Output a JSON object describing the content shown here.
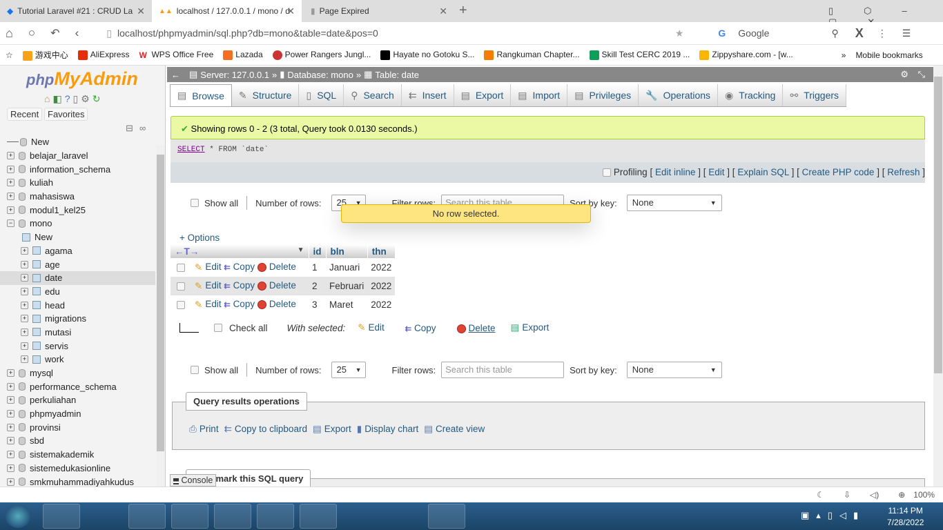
{
  "browser": {
    "tabs": [
      {
        "title": "Tutorial Laravel #21 : CRUD La"
      },
      {
        "title": "localhost / 127.0.0.1 / mono / d"
      },
      {
        "title": "Page Expired"
      }
    ],
    "url": "localhost/phpmyadmin/sql.php?db=mono&table=date&pos=0",
    "search_engine": "Google",
    "bookmarks": [
      "游戏中心",
      "AliExpress",
      "WPS Office Free",
      "Lazada",
      "Power Rangers Jungl...",
      "Hayate no Gotoku S...",
      "Rangkuman Chapter...",
      "Skill Test CERC 2019 ...",
      "Zippyshare.com - [w..."
    ],
    "mobile_bookmarks": "Mobile bookmarks"
  },
  "sidebar": {
    "logo": "phpMyAdmin",
    "recent": "Recent",
    "favorites": "Favorites",
    "tree": [
      {
        "label": "New",
        "type": "new"
      },
      {
        "label": "belajar_laravel"
      },
      {
        "label": "information_schema"
      },
      {
        "label": "kuliah"
      },
      {
        "label": "mahasiswa"
      },
      {
        "label": "modul1_kel25"
      },
      {
        "label": "mono",
        "expanded": true
      },
      {
        "label": "New",
        "type": "new",
        "child": true
      },
      {
        "label": "agama",
        "child": true
      },
      {
        "label": "age",
        "child": true
      },
      {
        "label": "date",
        "child": true,
        "selected": true
      },
      {
        "label": "edu",
        "child": true
      },
      {
        "label": "head",
        "child": true
      },
      {
        "label": "migrations",
        "child": true
      },
      {
        "label": "mutasi",
        "child": true
      },
      {
        "label": "servis",
        "child": true
      },
      {
        "label": "work",
        "child": true
      },
      {
        "label": "mysql"
      },
      {
        "label": "performance_schema"
      },
      {
        "label": "perkuliahan"
      },
      {
        "label": "phpmyadmin"
      },
      {
        "label": "provinsi"
      },
      {
        "label": "sbd"
      },
      {
        "label": "sistemakademik"
      },
      {
        "label": "sistemedukasionline"
      },
      {
        "label": "smkmuhammadiyahkudus"
      }
    ]
  },
  "breadcrumb": {
    "server": "Server: 127.0.0.1",
    "database": "Database: mono",
    "table": "Table: date"
  },
  "menu": [
    "Browse",
    "Structure",
    "SQL",
    "Search",
    "Insert",
    "Export",
    "Import",
    "Privileges",
    "Operations",
    "Tracking",
    "Triggers"
  ],
  "result": {
    "message": "Showing rows 0 - 2 (3 total, Query took 0.0130 seconds.)",
    "sql_kw": "SELECT",
    "sql_rest": " * FROM `date`",
    "profiling": "Profiling",
    "links": [
      "Edit inline",
      "Edit",
      "Explain SQL",
      "Create PHP code",
      "Refresh"
    ]
  },
  "nav": {
    "show_all": "Show all",
    "num_rows_label": "Number of rows:",
    "num_rows": "25",
    "filter_label": "Filter rows:",
    "filter_placeholder": "Search this table",
    "sort_label": "Sort by key:",
    "sort_value": "None"
  },
  "toast": "No row selected.",
  "options": "+ Options",
  "table": {
    "columns": [
      "id",
      "bln",
      "thn"
    ],
    "actions": [
      "Edit",
      "Copy",
      "Delete"
    ],
    "rows": [
      [
        "1",
        "Januari",
        "2022"
      ],
      [
        "2",
        "Februari",
        "2022"
      ],
      [
        "3",
        "Maret",
        "2022"
      ]
    ]
  },
  "bulk": {
    "check_all": "Check all",
    "with_selected": "With selected:",
    "edit": "Edit",
    "copy": "Copy",
    "delete": "Delete",
    "export": "Export"
  },
  "qro": {
    "title": "Query results operations",
    "items": [
      "Print",
      "Copy to clipboard",
      "Export",
      "Display chart",
      "Create view"
    ]
  },
  "bookmark_title": "Bookmark this SQL query",
  "console": "Console",
  "status": {
    "zoom": "100%"
  },
  "taskbar": {
    "time": "11:14 PM",
    "date": "7/28/2022"
  }
}
